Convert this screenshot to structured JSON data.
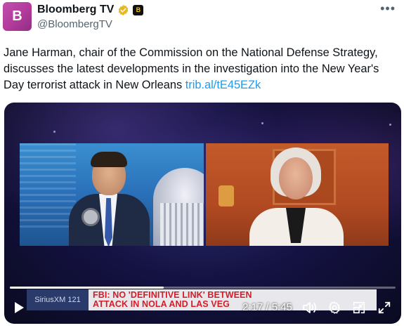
{
  "account": {
    "display_name": "Bloomberg TV",
    "handle": "@BloombergTV",
    "avatar_letter": "B",
    "affiliate_badge_letter": "B",
    "verified_color": "#e8b820",
    "more_icon": "more-horizontal-icon"
  },
  "tweet": {
    "text": "Jane Harman, chair of the Commission on the National Defense Strategy, discusses the latest developments in the investigation into the New Year's Day terrorist attack in New Orleans ",
    "link_text": "trib.al/tE45EZk",
    "link_color": "#1d9bf0"
  },
  "video": {
    "lower_third_brand": "SiriusXM 121",
    "headline_line1": "FBI: NO 'DEFINITIVE LINK' BETWEEN",
    "headline_line2": "ATTACK IN NOLA AND LAS VEG",
    "headline_color": "#d21d28",
    "time_display": "2:17 / 5:45",
    "progress": 0.398,
    "icons": [
      "play-icon",
      "volume-icon",
      "settings-icon",
      "pip-icon",
      "fullscreen-icon"
    ]
  }
}
